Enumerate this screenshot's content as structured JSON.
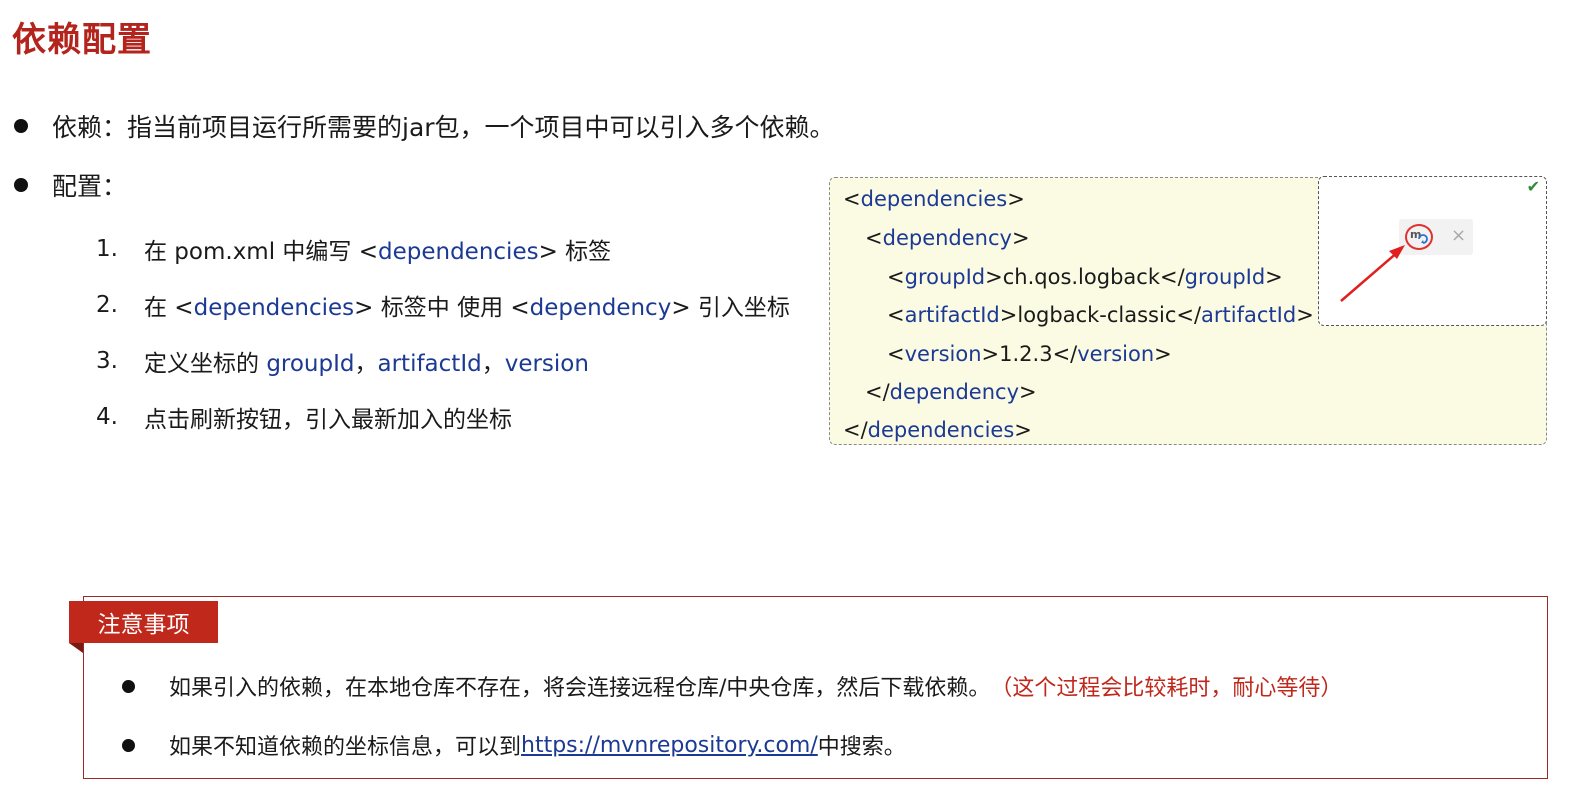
{
  "title": "依赖配置",
  "bullets": [
    "依赖：指当前项目运行所需要的jar包，一个项目中可以引入多个依赖。",
    "配置："
  ],
  "steps": [
    {
      "num": "1.",
      "parts": [
        "在 pom.xml 中编写 <",
        "dependencies",
        "> 标签"
      ]
    },
    {
      "num": "2.",
      "parts": [
        "在 <",
        "dependencies",
        "> 标签中 使用 <",
        "dependency",
        "> 引入坐标"
      ]
    },
    {
      "num": "3.",
      "parts": [
        "定义坐标的 ",
        "groupId",
        "，",
        "artifactId",
        "，",
        "version"
      ]
    },
    {
      "num": "4.",
      "parts": [
        "点击刷新按钮，引入最新加入的坐标"
      ]
    }
  ],
  "code": {
    "lines": [
      {
        "open": "<",
        "tag": "dependencies",
        "close": ">",
        "text": "",
        "endopen": "",
        "endtag": "",
        "endclose": ""
      },
      {
        "open": "<",
        "tag": "dependency",
        "close": ">",
        "text": "",
        "endopen": "",
        "endtag": "",
        "endclose": ""
      },
      {
        "open": "<",
        "tag": "groupId",
        "close": ">",
        "text": "ch.qos.logback",
        "endopen": "</",
        "endtag": "groupId",
        "endclose": ">"
      },
      {
        "open": "<",
        "tag": "artifactId",
        "close": ">",
        "text": "logback-classic",
        "endopen": "</",
        "endtag": "artifactId",
        "endclose": ">"
      },
      {
        "open": "<",
        "tag": "version",
        "close": ">",
        "text": "1.2.3",
        "endopen": "</",
        "endtag": "version",
        "endclose": ">"
      },
      {
        "open": "</",
        "tag": "dependency",
        "close": ">",
        "text": "",
        "endopen": "",
        "endtag": "",
        "endclose": ""
      },
      {
        "open": "</",
        "tag": "dependencies",
        "close": ">",
        "text": "",
        "endopen": "",
        "endtag": "",
        "endclose": ""
      }
    ]
  },
  "popup": {
    "check_icon": "check-icon",
    "maven_icon": "maven-refresh-icon",
    "close_symbol": "×",
    "maven_letter": "m"
  },
  "notice": {
    "tag": "注意事项",
    "item1": "如果引入的依赖，在本地仓库不存在，将会连接远程仓库/中央仓库，然后下载依赖。",
    "item1_note": "（这个过程会比较耗时，耐心等待）",
    "item2_pre": "如果不知道依赖的坐标信息，可以到",
    "item2_link": "https://mvnrepository.com/",
    "item2_post": "中搜索。"
  },
  "colors": {
    "title": "#b3241c",
    "tag_blue": "#1c3a94",
    "notice_red": "#c0281c"
  }
}
